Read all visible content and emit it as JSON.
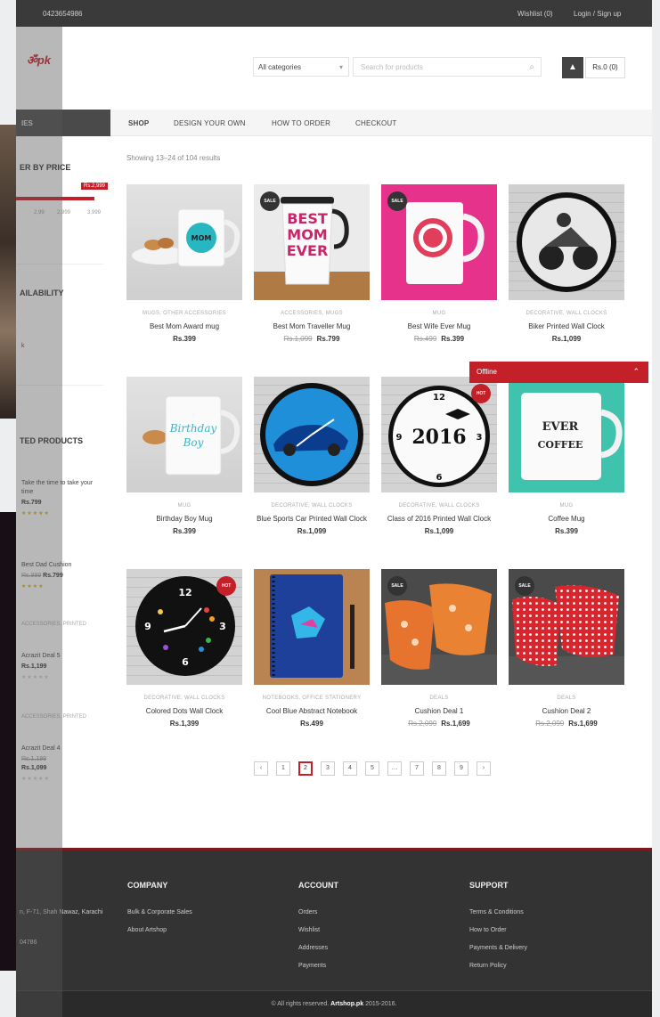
{
  "topbar": {
    "phone": "0423654986",
    "wishlist": "Wishlist (0)",
    "login": "Login / Sign up"
  },
  "logo": {
    "text": "ॐpk"
  },
  "search": {
    "category": "All categories",
    "placeholder": "Search for products"
  },
  "cart": {
    "label": "Rs.0 (0)"
  },
  "sidebar": {
    "categories_heading": "IES",
    "filter_heading": "ER BY PRICE",
    "price_tag": "Rs.2,999",
    "price_labels": [
      "2,99",
      "2,999",
      "3,999"
    ],
    "availability_heading": "AILABILITY",
    "availability_item": "k",
    "top_products_heading": "TED PRODUCTS",
    "top_products": [
      {
        "cat": "",
        "name": "Take the time to take your time",
        "price": "Rs.799",
        "old": ""
      },
      {
        "cat": "",
        "name": "Best Dad Cushion",
        "price": "Rs.799",
        "old": "Rs.999"
      },
      {
        "cat": "ACCESSORIES, PRINTED",
        "name": "Acrazit Deal 5",
        "price": "Rs.1,199",
        "old": ""
      },
      {
        "cat": "ACCESSORIES, PRINTED",
        "name": "Acrazit Deal 4",
        "price": "Rs.1,099",
        "old": "Rs.1,199"
      }
    ]
  },
  "nav": {
    "items": [
      "SHOP",
      "DESIGN YOUR OWN",
      "HOW TO ORDER",
      "CHECKOUT"
    ]
  },
  "results_text": "Showing 13–24 of 104 results",
  "products": [
    {
      "cat": "MUGS, OTHER ACCESSORIES",
      "name": "Best Mom Award mug",
      "price": "Rs.399",
      "old": "",
      "badge": ""
    },
    {
      "cat": "ACCESSORIES, MUGS",
      "name": "Best Mom Traveller Mug",
      "price": "Rs.799",
      "old": "Rs.1,099",
      "badge": "SALE"
    },
    {
      "cat": "MUG",
      "name": "Best Wife Ever Mug",
      "price": "Rs.399",
      "old": "Rs.499",
      "badge": "SALE"
    },
    {
      "cat": "DECORATIVE, WALL CLOCKS",
      "name": "Biker Printed Wall Clock",
      "price": "Rs.1,099",
      "old": "",
      "badge": ""
    },
    {
      "cat": "MUG",
      "name": "Birthday Boy Mug",
      "price": "Rs.399",
      "old": "",
      "badge": ""
    },
    {
      "cat": "DECORATIVE, WALL CLOCKS",
      "name": "Blue Sports Car Printed Wall Clock",
      "price": "Rs.1,099",
      "old": "",
      "badge": ""
    },
    {
      "cat": "DECORATIVE, WALL CLOCKS",
      "name": "Class of 2016 Printed Wall Clock",
      "price": "Rs.1,099",
      "old": "",
      "badge": "HOT"
    },
    {
      "cat": "MUG",
      "name": "Coffee Mug",
      "price": "Rs.399",
      "old": "",
      "badge": ""
    },
    {
      "cat": "DECORATIVE, WALL CLOCKS",
      "name": "Colored Dots Wall Clock",
      "price": "Rs.1,399",
      "old": "",
      "badge": "HOT"
    },
    {
      "cat": "NOTEBOOKS, OFFICE STATIONERY",
      "name": "Cool Blue Abstract Notebook",
      "price": "Rs.499",
      "old": "",
      "badge": ""
    },
    {
      "cat": "DEALS",
      "name": "Cushion Deal 1",
      "price": "Rs.1,699",
      "old": "Rs.2,099",
      "badge": "SALE"
    },
    {
      "cat": "DEALS",
      "name": "Cushion Deal 2",
      "price": "Rs.1,699",
      "old": "Rs.2,099",
      "badge": "SALE"
    }
  ],
  "art": {
    "best_mom": "BEST MOM EVER",
    "year": "2016",
    "ever": "EVER",
    "coffee": "COFFEE",
    "mug_mom": "MOM"
  },
  "pagination": [
    "‹",
    "1",
    "2",
    "3",
    "4",
    "5",
    "…",
    "7",
    "8",
    "9",
    "›"
  ],
  "chat": {
    "label": "Offline"
  },
  "footer": {
    "company_title": "COMPANY",
    "company_links": [
      "Bulk & Corporate Sales",
      "About Artshop"
    ],
    "account_title": "ACCOUNT",
    "account_links": [
      "Orders",
      "Wishlist",
      "Addresses",
      "Payments"
    ],
    "support_title": "SUPPORT",
    "support_links": [
      "Terms & Conditions",
      "How to Order",
      "Payments & Delivery",
      "Return Policy"
    ],
    "address": "n, F-71, Shah Nawaz, Karachi",
    "phone": "04786"
  },
  "copyright": {
    "prefix": "© All rights reserved.",
    "brand": "Artshop.pk",
    "years": "2015-2016."
  }
}
